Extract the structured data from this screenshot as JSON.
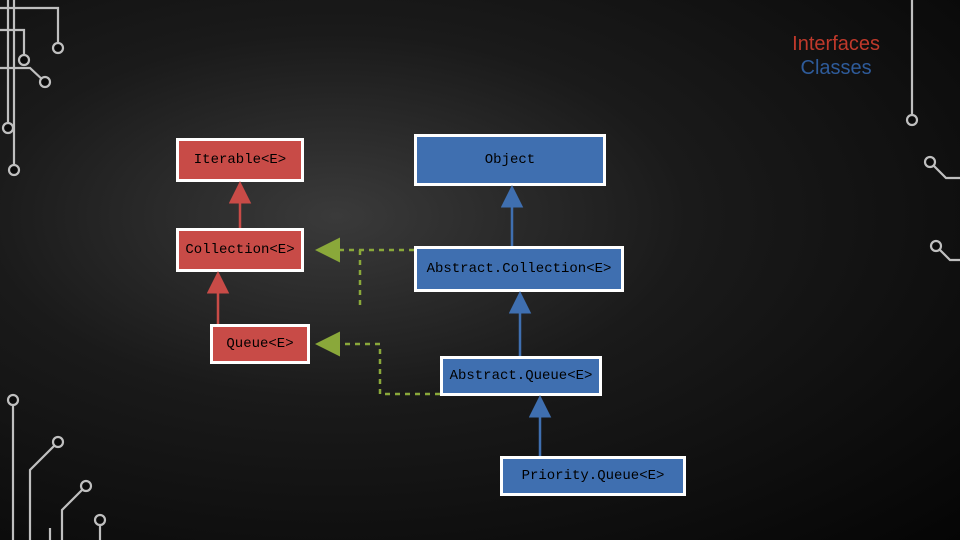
{
  "legend": {
    "interfaces": "Interfaces",
    "classes": "Classes"
  },
  "nodes": {
    "iterable": "Iterable<E>",
    "collection": "Collection<E>",
    "queue": "Queue<E>",
    "object": "Object",
    "abscoll": "Abstract.Collection<E>",
    "absqueue": "Abstract.Queue<E>",
    "pqueue": "Priority.Queue<E>"
  },
  "chart_data": {
    "type": "diagram",
    "title": "Java Queue collection hierarchy",
    "legend": {
      "Interfaces": "red",
      "Classes": "blue"
    },
    "nodes": [
      {
        "id": "Iterable<E>",
        "kind": "interface"
      },
      {
        "id": "Collection<E>",
        "kind": "interface"
      },
      {
        "id": "Queue<E>",
        "kind": "interface"
      },
      {
        "id": "Object",
        "kind": "class"
      },
      {
        "id": "Abstract.Collection<E>",
        "kind": "class"
      },
      {
        "id": "Abstract.Queue<E>",
        "kind": "class"
      },
      {
        "id": "Priority.Queue<E>",
        "kind": "class"
      }
    ],
    "edges": [
      {
        "from": "Collection<E>",
        "to": "Iterable<E>",
        "relation": "extends"
      },
      {
        "from": "Queue<E>",
        "to": "Collection<E>",
        "relation": "extends"
      },
      {
        "from": "Abstract.Collection<E>",
        "to": "Object",
        "relation": "extends"
      },
      {
        "from": "Abstract.Queue<E>",
        "to": "Abstract.Collection<E>",
        "relation": "extends"
      },
      {
        "from": "Priority.Queue<E>",
        "to": "Abstract.Queue<E>",
        "relation": "extends"
      },
      {
        "from": "Abstract.Collection<E>",
        "to": "Collection<E>",
        "relation": "implements"
      },
      {
        "from": "Abstract.Queue<E>",
        "to": "Queue<E>",
        "relation": "implements"
      }
    ]
  }
}
